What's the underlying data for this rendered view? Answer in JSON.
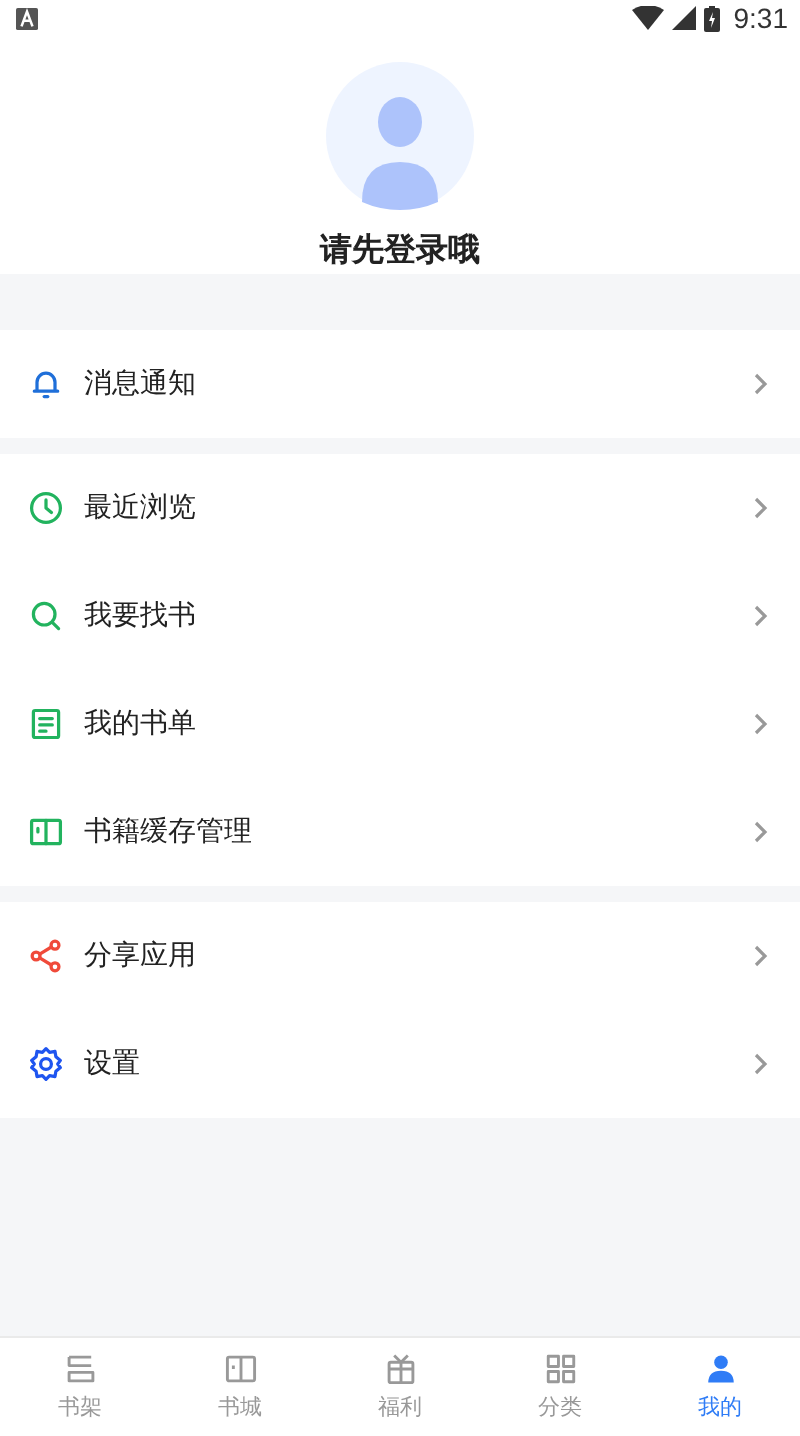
{
  "status_bar": {
    "time": "9:31"
  },
  "profile": {
    "login_prompt": "请先登录哦"
  },
  "menu_groups": [
    [
      {
        "kind": "bell",
        "label": "消息通知"
      }
    ],
    [
      {
        "kind": "clock",
        "label": "最近浏览"
      },
      {
        "kind": "search",
        "label": "我要找书"
      },
      {
        "kind": "list",
        "label": "我的书单"
      },
      {
        "kind": "book",
        "label": "书籍缓存管理"
      }
    ],
    [
      {
        "kind": "share",
        "label": "分享应用"
      },
      {
        "kind": "gear",
        "label": "设置"
      }
    ]
  ],
  "tab_bar": [
    {
      "kind": "shelf",
      "label": "书架",
      "selected": false
    },
    {
      "kind": "book",
      "label": "书城",
      "selected": false
    },
    {
      "kind": "gift",
      "label": "福利",
      "selected": false
    },
    {
      "kind": "grid",
      "label": "分类",
      "selected": false
    },
    {
      "kind": "person",
      "label": "我的",
      "selected": true
    }
  ]
}
